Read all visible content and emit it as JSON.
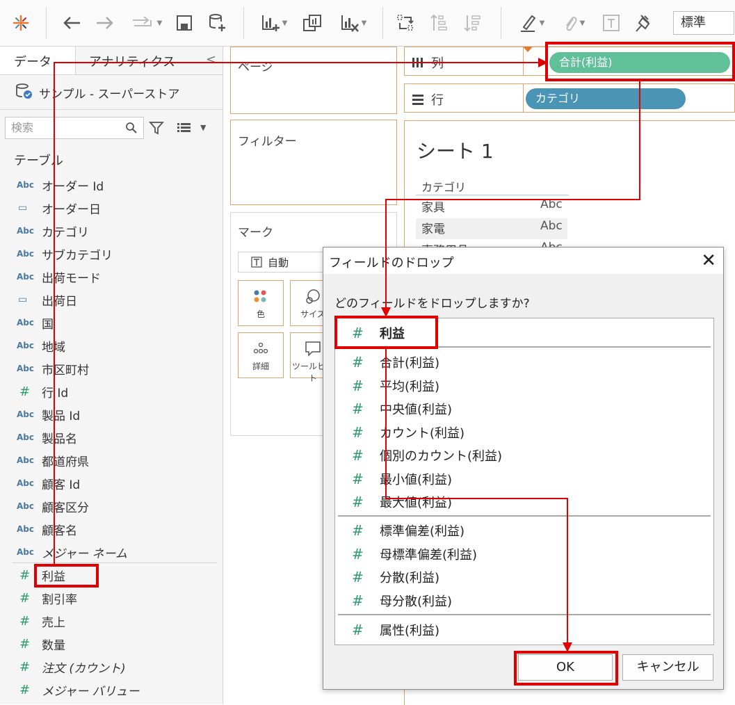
{
  "toolbar": {
    "preset_value": "標準",
    "icons": [
      "tableau-logo-icon",
      "undo-icon",
      "redo-icon",
      "replay-icon",
      "save-icon",
      "new-datasource-icon",
      "new-worksheet-icon",
      "duplicate-icon",
      "clear-sheet-icon",
      "swap-icon",
      "sort-ascending-icon",
      "sort-descending-icon",
      "highlight-icon",
      "group-icon",
      "label-icon",
      "pin-icon"
    ]
  },
  "left": {
    "tab_data": "データ",
    "tab_analytics": "アナリティクス",
    "collapse": "<",
    "datasource": "サンプル - スーパーストア",
    "search_placeholder": "検索",
    "section_tables": "テーブル",
    "fields": [
      {
        "type": "Abc",
        "label": "オーダー Id"
      },
      {
        "type": "date",
        "label": "オーダー日"
      },
      {
        "type": "Abc",
        "label": "カテゴリ"
      },
      {
        "type": "Abc",
        "label": "サブカテゴリ"
      },
      {
        "type": "Abc",
        "label": "出荷モード"
      },
      {
        "type": "date",
        "label": "出荷日"
      },
      {
        "type": "Abc",
        "label": "国"
      },
      {
        "type": "Abc",
        "label": "地域"
      },
      {
        "type": "Abc",
        "label": "市区町村"
      },
      {
        "type": "#",
        "label": "行 Id"
      },
      {
        "type": "Abc",
        "label": "製品 Id"
      },
      {
        "type": "Abc",
        "label": "製品名"
      },
      {
        "type": "Abc",
        "label": "都道府県"
      },
      {
        "type": "Abc",
        "label": "顧客 Id"
      },
      {
        "type": "Abc",
        "label": "顧客区分"
      },
      {
        "type": "Abc",
        "label": "顧客名"
      },
      {
        "type": "Abc",
        "label": "メジャー ネーム"
      }
    ],
    "measures": [
      {
        "type": "#",
        "label": "利益"
      },
      {
        "type": "#",
        "label": "割引率"
      },
      {
        "type": "#",
        "label": "売上"
      },
      {
        "type": "#",
        "label": "数量"
      },
      {
        "type": "#",
        "label": "注文 (カウント)"
      },
      {
        "type": "#",
        "label": "メジャー バリュー"
      }
    ]
  },
  "shelves": {
    "pages": "ページ",
    "filters": "フィルター",
    "marks": "マーク",
    "marks_type": "自動",
    "mark_color": "色",
    "mark_size": "サイズ",
    "mark_detail": "詳細",
    "mark_tooltip": "ツールヒント",
    "columns_label": "列",
    "rows_label": "行",
    "columns_pill": "合計(利益)",
    "rows_pill": "カテゴリ",
    "pill_measure_color": "#5fc09a",
    "pill_dim_color": "#4a94b5"
  },
  "sheet": {
    "title": "シート 1",
    "header": "カテゴリ",
    "rows": [
      {
        "label": "家具",
        "value": "Abc"
      },
      {
        "label": "家電",
        "value": "Abc"
      },
      {
        "label": "事務用品",
        "value": "Abc"
      }
    ]
  },
  "dialog": {
    "title": "フィールドのドロップ",
    "close": "✕",
    "question": "どのフィールドをドロップしますか?",
    "group1": [
      "利益"
    ],
    "group2": [
      "合計(利益)",
      "平均(利益)",
      "中央値(利益)",
      "カウント(利益)",
      "個別のカウント(利益)",
      "最小値(利益)",
      "最大値(利益)"
    ],
    "group3": [
      "標準偏差(利益)",
      "母標準偏差(利益)",
      "分散(利益)",
      "母分散(利益)"
    ],
    "group4": [
      "属性(利益)"
    ],
    "ok": "OK",
    "cancel": "キャンセル"
  },
  "annotation_color": "#e00000"
}
